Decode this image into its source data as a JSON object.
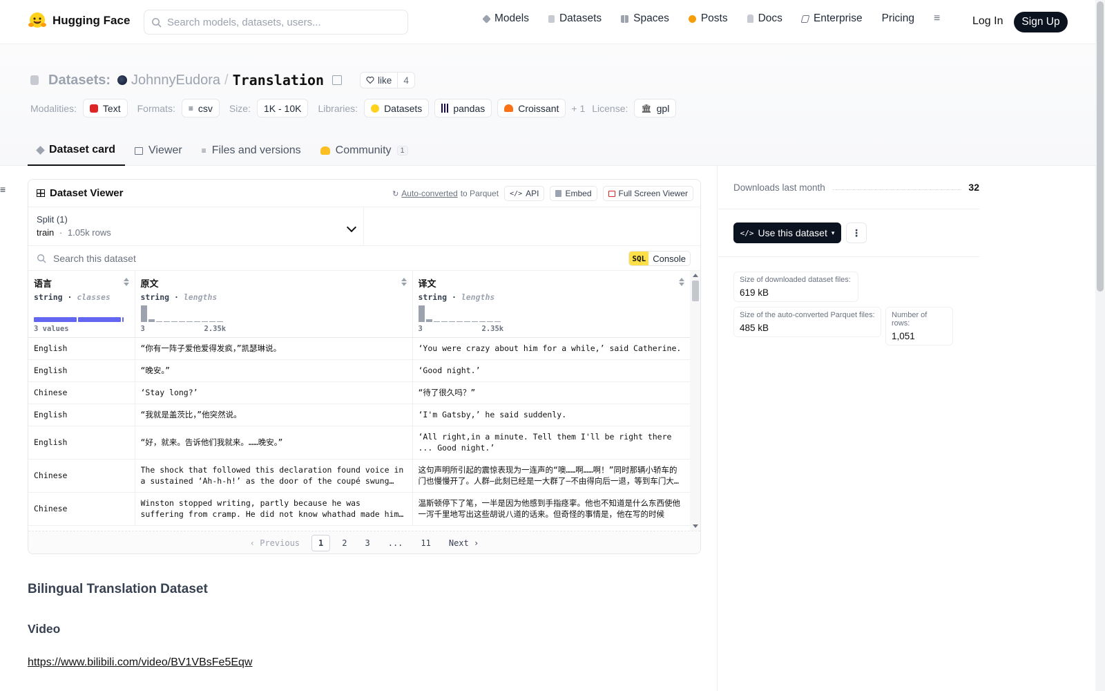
{
  "brand": {
    "name": "Hugging Face"
  },
  "search": {
    "placeholder": "Search models, datasets, users..."
  },
  "nav": {
    "items": [
      {
        "label": "Models",
        "icon": "cube-icon",
        "color": "#9ca3af"
      },
      {
        "label": "Datasets",
        "icon": "database-icon",
        "color": "#9ca3af"
      },
      {
        "label": "Spaces",
        "icon": "grid-icon",
        "color": "#9ca3af"
      },
      {
        "label": "Posts",
        "icon": "posts-icon",
        "color": "#f59e0b"
      },
      {
        "label": "Docs",
        "icon": "docs-icon",
        "color": "#9ca3af"
      },
      {
        "label": "Enterprise",
        "icon": "enterprise-icon",
        "color": "#6b7280"
      },
      {
        "label": "Pricing"
      }
    ],
    "login": "Log In",
    "signup": "Sign Up"
  },
  "header": {
    "section": "Datasets:",
    "owner": "JohnnyEudora",
    "separator": "/",
    "repo": "Translation",
    "like_label": "like",
    "like_count": "4",
    "meta": {
      "modalities_label": "Modalities:",
      "modality": "Text",
      "formats_label": "Formats:",
      "format": "csv",
      "size_label": "Size:",
      "size": "1K - 10K",
      "libraries_label": "Libraries:",
      "libraries": [
        "Datasets",
        "pandas",
        "Croissant"
      ],
      "libraries_more": "+ 1",
      "license_label": "License:",
      "license": "gpl"
    }
  },
  "tabs": {
    "card": "Dataset card",
    "viewer": "Viewer",
    "files": "Files and versions",
    "community": "Community",
    "community_count": "1"
  },
  "viewer": {
    "title": "Dataset Viewer",
    "auto_converted": "Auto-converted",
    "to_parquet": "to Parquet",
    "api": "API",
    "embed": "Embed",
    "full_screen": "Full Screen Viewer",
    "split_label": "Split (1)",
    "split_name": "train",
    "split_dot": "·",
    "split_rows": "1.05k rows",
    "search_placeholder": "Search this dataset",
    "sql_tag": "SQL",
    "sql_label": "Console",
    "columns": [
      {
        "name": "语言",
        "type": "string",
        "kind": "classes",
        "summary": "3 values"
      },
      {
        "name": "原文",
        "type": "string",
        "kind": "lengths",
        "min": "3",
        "max": "2.35k"
      },
      {
        "name": "译文",
        "type": "string",
        "kind": "lengths",
        "min": "3",
        "max": "2.35k"
      }
    ],
    "rows": [
      [
        "English",
        "“你有一阵子爱他爱得发疯，”凯瑟琳说。",
        "‘You were crazy about him for a while,’ said Catherine."
      ],
      [
        "English",
        "“晚安。”",
        "‘Good night.’"
      ],
      [
        "Chinese",
        "‘Stay long?’",
        "“待了很久吗？”"
      ],
      [
        "English",
        "“我就是盖茨比，”他突然说。",
        "‘I'm Gatsby,’ he said suddenly."
      ],
      [
        "English",
        "“好，就来。告诉他们我就来。……晚安。”",
        "‘All right,in a minute. Tell them I'll be right there ... Good night.’"
      ],
      [
        "Chinese",
        "The shock that followed this declaration found voice in a sustained ‘Ah-h-h!’ as the door of the coupé swung open.",
        "这句声明所引起的震惊表现为一连声的“噢……啊……啊！”同时那辆小轿车的门也慢慢开了。人群—此刻已经是一大群了—不由得向后一退，等到车门大开时，"
      ],
      [
        "Chinese",
        "Winston stopped writing, partly because he was suffering from cramp. He did not know whathad made him pour out this stream of rubbish.",
        "温斯顿停下了笔，一半是因为他感到手指痉挛。他也不知道是什么东西使他一泻千里地写出这些胡说八道的话来。但奇怪的事情是，他在写的时候"
      ]
    ],
    "pager": {
      "prev": "Previous",
      "pages": [
        "1",
        "2",
        "3",
        "...",
        "11"
      ],
      "next": "Next"
    }
  },
  "card": {
    "heading": "Bilingual Translation Dataset",
    "subheading": "Video",
    "link": "https://www.bilibili.com/video/BV1VBsFe5Eqw"
  },
  "sidebar": {
    "downloads_label": "Downloads last month",
    "downloads": "32",
    "use_button": "Use this dataset",
    "stats": [
      {
        "label": "Size of downloaded dataset files:",
        "value": "619 kB"
      },
      {
        "label": "Size of the auto-converted Parquet files:",
        "value": "485 kB"
      },
      {
        "label": "Number of rows:",
        "value": "1,051"
      }
    ]
  },
  "colors": {
    "accent_dark": "#0b1220",
    "class_bar": "#6366f1",
    "sql_yellow": "#fde047"
  }
}
